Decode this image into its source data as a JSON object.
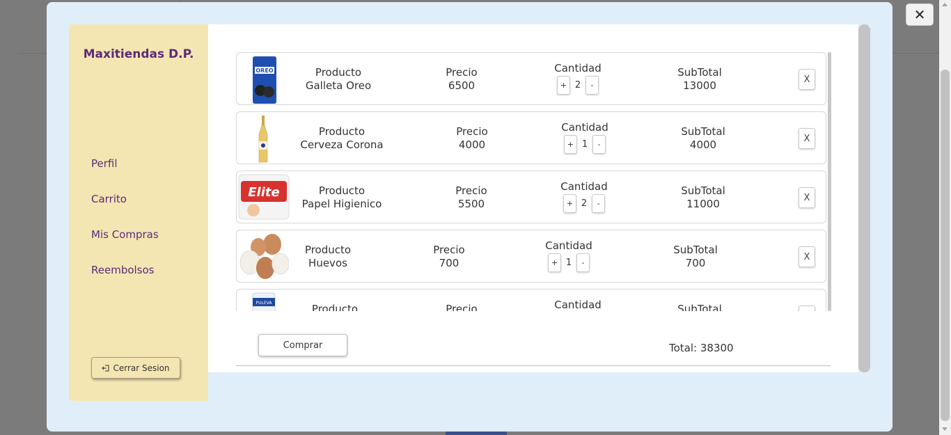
{
  "app": {
    "brand": "Maxitiendas D.P."
  },
  "sidebar": {
    "items": [
      {
        "label": "Perfil"
      },
      {
        "label": "Carrito"
      },
      {
        "label": "Mis Compras"
      },
      {
        "label": "Reembolsos"
      }
    ],
    "logout_label": "Cerrar Sesion"
  },
  "cart": {
    "labels": {
      "product": "Producto",
      "price": "Precio",
      "quantity": "Cantidad",
      "subtotal": "SubTotal",
      "plus": "+",
      "minus": "-",
      "remove": "X"
    },
    "items": [
      {
        "name": "Galleta Oreo",
        "price": "6500",
        "qty": "2",
        "subtotal": "13000",
        "icon": "oreo-cookie-image"
      },
      {
        "name": "Cerveza Corona",
        "price": "4000",
        "qty": "1",
        "subtotal": "4000",
        "icon": "corona-beer-image"
      },
      {
        "name": "Papel Higienico",
        "price": "5500",
        "qty": "2",
        "subtotal": "11000",
        "icon": "toilet-paper-image"
      },
      {
        "name": "Huevos",
        "price": "700",
        "qty": "1",
        "subtotal": "700",
        "icon": "eggs-image"
      },
      {
        "name": "",
        "price": "",
        "qty": "",
        "subtotal": "",
        "icon": "milk-image"
      }
    ],
    "buy_label": "Comprar",
    "total_label": "Total:",
    "total_value": "38300"
  },
  "close_label": "✕",
  "colors": {
    "brand": "#5d2a78",
    "sidebar_bg": "#f3e6b3",
    "modal_bg": "#dfeef8",
    "overlay": "#7b7b7b"
  }
}
